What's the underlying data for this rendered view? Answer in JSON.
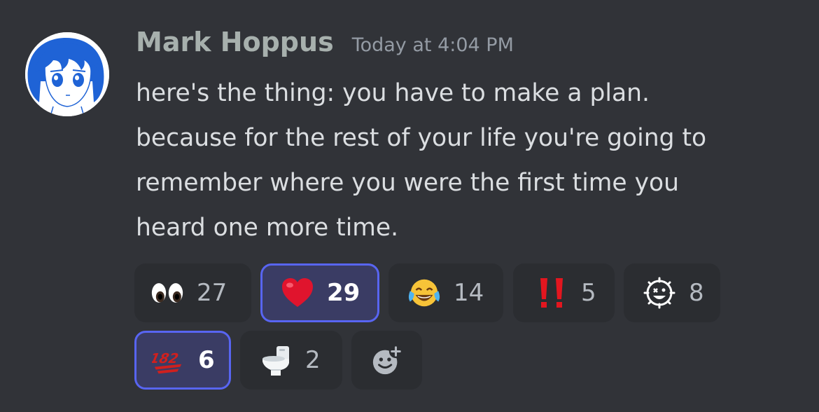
{
  "author": {
    "name": "Mark Hoppus",
    "timestamp": "Today at 4:04 PM",
    "avatar_icon": "anime-girl-avatar"
  },
  "message": {
    "lines": [
      "here's the thing: you have to make a plan.",
      "because for the rest of your life you're going to",
      "remember where you were the first time you",
      "heard one more time."
    ]
  },
  "reactions": [
    {
      "emoji": "eyes",
      "count": "27",
      "active": false
    },
    {
      "emoji": "red-heart",
      "count": "29",
      "active": true
    },
    {
      "emoji": "face-with-tears-of-joy",
      "count": "14",
      "active": false
    },
    {
      "emoji": "double-exclamation",
      "count": "5",
      "active": false
    },
    {
      "emoji": "blink-182-smiley",
      "count": "8",
      "active": false
    },
    {
      "emoji": "blink-182-logo",
      "count": "6",
      "active": true
    },
    {
      "emoji": "toilet",
      "count": "2",
      "active": false
    }
  ],
  "add_reaction_icon": "add-reaction-icon",
  "colors": {
    "background": "#313338",
    "username": "#a7b0ad",
    "active_border": "#5865f2"
  }
}
